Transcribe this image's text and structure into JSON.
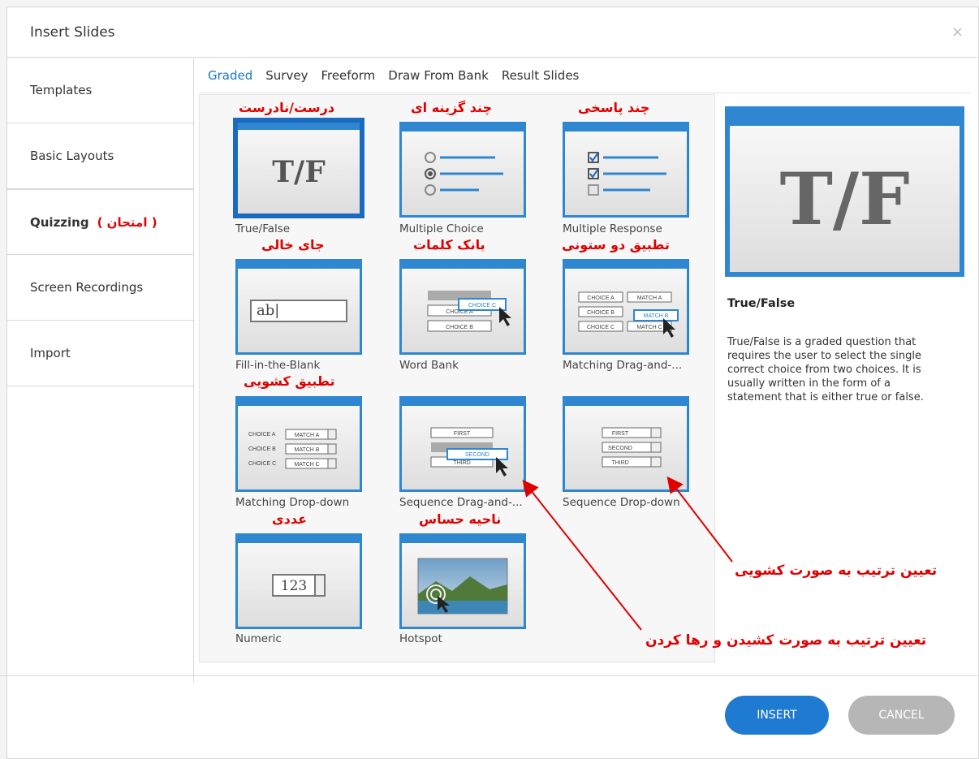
{
  "dialog": {
    "title": "Insert Slides",
    "close_glyph": "×"
  },
  "sidebar": {
    "items": [
      {
        "label": "Templates"
      },
      {
        "label": "Basic Layouts"
      },
      {
        "label": "Quizzing",
        "note": "( امتحان )"
      },
      {
        "label": "Screen Recordings"
      },
      {
        "label": "Import"
      }
    ]
  },
  "tabs": [
    {
      "label": "Graded",
      "selected": true
    },
    {
      "label": "Survey"
    },
    {
      "label": "Freeform"
    },
    {
      "label": "Draw From Bank"
    },
    {
      "label": "Result Slides"
    }
  ],
  "cards": [
    {
      "label": "True/False",
      "fa": "درست/نادرست",
      "selected": true,
      "icon": "tf-icon"
    },
    {
      "label": "Multiple Choice",
      "fa": "چند گزینه ای",
      "icon": "multiple-choice-icon"
    },
    {
      "label": "Multiple Response",
      "fa": "چند پاسخی",
      "icon": "multiple-response-icon"
    },
    {
      "label": "Fill-in-the-Blank",
      "fa": "جای خالی",
      "icon": "fill-blank-icon",
      "sample": "ab|"
    },
    {
      "label": "Word Bank",
      "fa": "بانک کلمات",
      "icon": "word-bank-icon"
    },
    {
      "label": "Matching  Drag-and-...",
      "fa": "تطبیق دو ستونی",
      "icon": "matching-drag-icon"
    },
    {
      "label": "Matching Drop-down",
      "fa": "تطبیق کشویی",
      "icon": "matching-dropdown-icon"
    },
    {
      "label": "Sequence  Drag-and-...",
      "fa": "",
      "icon": "sequence-drag-icon"
    },
    {
      "label": "Sequence Drop-down",
      "fa": "",
      "icon": "sequence-dropdown-icon"
    },
    {
      "label": "Numeric",
      "fa": "عددی",
      "icon": "numeric-icon",
      "sample": "123"
    },
    {
      "label": "Hotspot",
      "fa": "ناحیه حساس",
      "icon": "hotspot-icon"
    }
  ],
  "thumb_text": {
    "tf": "T/F",
    "choice_a": "CHOICE A",
    "choice_b": "CHOICE B",
    "choice_c": "CHOICE C",
    "match_a": "MATCH A",
    "match_b": "MATCH B",
    "match_c": "MATCH C",
    "first": "FIRST",
    "second": "SECOND",
    "third": "THIRD"
  },
  "preview": {
    "glyph": "T/F",
    "title": "True/False",
    "description": "True/False is a graded question that requires the user to select the single correct choice from two choices.  It is usually written in the form of a statement that is either true or false."
  },
  "annotations": {
    "dropdown": "تعیین ترتیب به صورت کشویی",
    "dragdrop": "تعیین ترتیب به صورت کشیدن و رها کردن"
  },
  "buttons": {
    "insert": "INSERT",
    "cancel": "CANCEL"
  },
  "colors": {
    "accent": "#2f86d1",
    "annotation": "#e00000"
  }
}
